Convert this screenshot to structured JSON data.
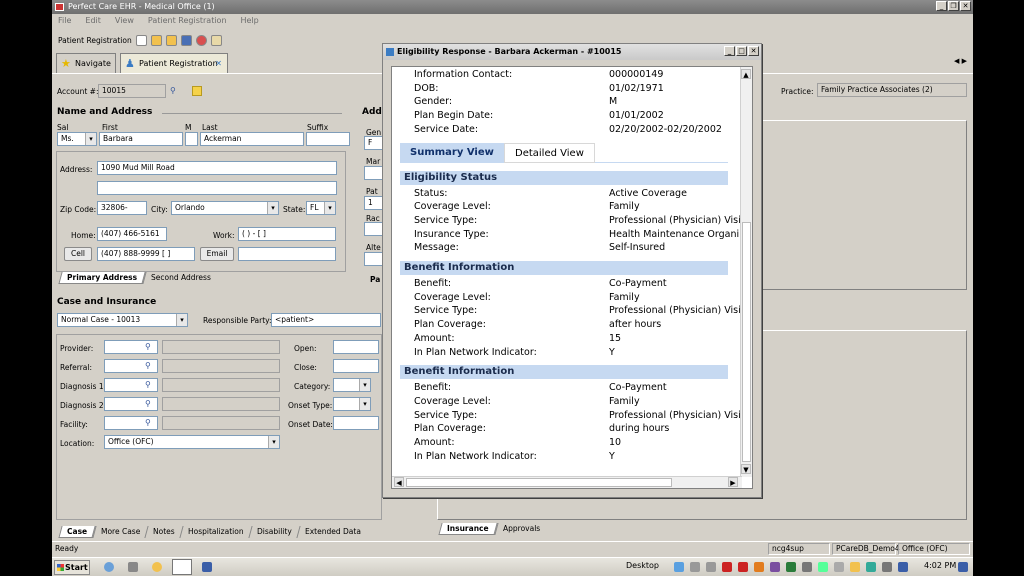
{
  "window": {
    "title": "Perfect Care EHR - Medical Office (1)"
  },
  "menu": [
    "File",
    "Edit",
    "View",
    "Patient Registration",
    "Help"
  ],
  "toolbar": {
    "label": "Patient Registration"
  },
  "tabs": {
    "navigate": "Navigate",
    "patient_registration": "Patient Registration"
  },
  "account": {
    "label": "Account #:",
    "value": "10015"
  },
  "practice": {
    "label": "Practice:",
    "value": "Family Practice Associates (2)"
  },
  "name_address": {
    "header": "Name and Address",
    "sal_label": "Sal",
    "first_label": "First",
    "m_label": "M",
    "last_label": "Last",
    "suffix_label": "Suffix",
    "sal": "Ms.",
    "first": "Barbara",
    "last": "Ackerman",
    "address_label": "Address:",
    "address1": "1090 Mud Mill Road",
    "zip_label": "Zip Code:",
    "zip": "32806-",
    "city_label": "City:",
    "city": "Orlando",
    "state_label": "State:",
    "state": "FL",
    "home_label": "Home:",
    "home": "(407) 466-5161",
    "work_label": "Work:",
    "work": "(   )    -    [   ]",
    "cell_button": "Cell",
    "cell": "(407) 888-9999  [   ]",
    "email_button": "Email"
  },
  "address_tabs": [
    "Primary Address",
    "Second Address"
  ],
  "right_header": "Add",
  "right_labels": [
    "Gen",
    "F",
    "Mar",
    "Pat",
    "1",
    "Rac",
    "Alte",
    "Pa"
  ],
  "case_insurance": {
    "header": "Case and Insurance",
    "case": "Normal Case - 10013",
    "responsible_label": "Responsible Party:",
    "responsible": "<patient>",
    "provider": "Provider:",
    "referral": "Referral:",
    "diagnosis1": "Diagnosis 1:",
    "diagnosis2": "Diagnosis 2:",
    "facility": "Facility:",
    "location": "Location:",
    "location_value": "Office (OFC)",
    "open": "Open:",
    "close": "Close:",
    "category": "Category:",
    "onset_type": "Onset Type:",
    "onset_date": "Onset Date:"
  },
  "bottom_tabs": [
    "Case",
    "More Case",
    "Notes",
    "Hospitalization",
    "Disability",
    "Extended Data"
  ],
  "insurance_tabs": [
    "Insurance",
    "Approvals"
  ],
  "status": {
    "text": "Ready",
    "user": "ncg4sup",
    "db": "PCareDB_Demo4",
    "location": "Office (OFC)"
  },
  "taskbar": {
    "start": "Start",
    "desktop": "Desktop",
    "time": "4:02 PM"
  },
  "dialog": {
    "title": "Eligibility Response - Barbara Ackerman - #10015",
    "top_rows": [
      {
        "label": "Information Contact:",
        "value": "000000149"
      },
      {
        "label": "DOB:",
        "value": "01/02/1971"
      },
      {
        "label": "Gender:",
        "value": "M"
      },
      {
        "label": "Plan Begin Date:",
        "value": "01/01/2002"
      },
      {
        "label": "Service Date:",
        "value": "02/20/2002-02/20/2002"
      }
    ],
    "view_tabs": [
      "Summary View",
      "Detailed View"
    ],
    "sections": [
      {
        "title": "Eligibility Status",
        "rows": [
          {
            "label": "Status:",
            "value": "Active Coverage"
          },
          {
            "label": "Coverage Level:",
            "value": "Family"
          },
          {
            "label": "Service Type:",
            "value": "Professional (Physician) Visi"
          },
          {
            "label": "Insurance Type:",
            "value": "Health Maintenance Organi"
          },
          {
            "label": "Message:",
            "value": "Self-Insured"
          }
        ]
      },
      {
        "title": "Benefit Information",
        "rows": [
          {
            "label": "Benefit:",
            "value": "Co-Payment"
          },
          {
            "label": "Coverage Level:",
            "value": "Family"
          },
          {
            "label": "Service Type:",
            "value": "Professional (Physician) Visi"
          },
          {
            "label": "Plan Coverage:",
            "value": "after hours"
          },
          {
            "label": "Amount:",
            "value": "15"
          },
          {
            "label": "In Plan Network Indicator:",
            "value": "Y"
          }
        ]
      },
      {
        "title": "Benefit Information",
        "rows": [
          {
            "label": "Benefit:",
            "value": "Co-Payment"
          },
          {
            "label": "Coverage Level:",
            "value": "Family"
          },
          {
            "label": "Service Type:",
            "value": "Professional (Physician) Visi"
          },
          {
            "label": "Plan Coverage:",
            "value": "during hours"
          },
          {
            "label": "Amount:",
            "value": "10"
          },
          {
            "label": "In Plan Network Indicator:",
            "value": "Y"
          }
        ]
      }
    ]
  }
}
